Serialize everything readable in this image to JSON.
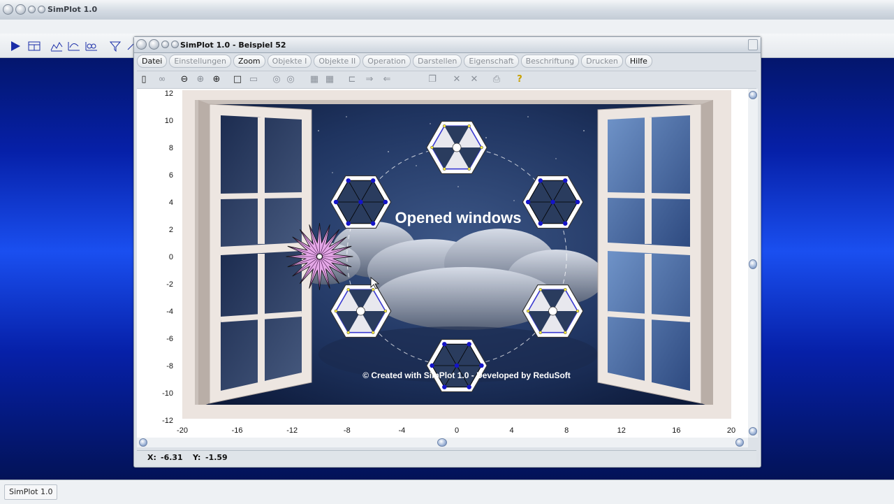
{
  "outer_window": {
    "title": "SimPlot 1.0"
  },
  "taskbar": {
    "item": "SimPlot 1.0"
  },
  "inner_window": {
    "title": "SimPlot 1.0 - Beispiel 52"
  },
  "menu": [
    {
      "label": "Datei",
      "enabled": true
    },
    {
      "label": "Einstellungen",
      "enabled": false
    },
    {
      "label": "Zoom",
      "enabled": true
    },
    {
      "label": "Objekte I",
      "enabled": false
    },
    {
      "label": "Objekte II",
      "enabled": false
    },
    {
      "label": "Operation",
      "enabled": false
    },
    {
      "label": "Darstellen",
      "enabled": false
    },
    {
      "label": "Eigenschaft",
      "enabled": false
    },
    {
      "label": "Beschriftung",
      "enabled": false
    },
    {
      "label": "Drucken",
      "enabled": false
    },
    {
      "label": "Hilfe",
      "enabled": true
    }
  ],
  "plot": {
    "x_ticks": [
      "-20",
      "-16",
      "-12",
      "-8",
      "-4",
      "0",
      "4",
      "8",
      "12",
      "16",
      "20"
    ],
    "y_ticks": [
      "12",
      "10",
      "8",
      "6",
      "4",
      "2",
      "0",
      "-2",
      "-4",
      "-6",
      "-8",
      "-10",
      "-12"
    ],
    "xlim": [
      -20,
      20
    ],
    "ylim": [
      -12,
      12
    ],
    "heading": "Opened windows",
    "credit": "© Created with SimPlot 1.0 - Developed by ReduSoft",
    "hexagons": [
      {
        "x": -7,
        "y": 4,
        "style": "spokes"
      },
      {
        "x": 7,
        "y": 4,
        "style": "spokes"
      },
      {
        "x": 0,
        "y": 8,
        "style": "fan"
      },
      {
        "x": -7,
        "y": -4,
        "style": "fan"
      },
      {
        "x": 7,
        "y": -4,
        "style": "fan"
      },
      {
        "x": 0,
        "y": -8,
        "style": "spokes"
      }
    ],
    "star": {
      "x": -10,
      "y": 0
    },
    "circle": {
      "cx": 0,
      "cy": 0,
      "r": 8
    },
    "colors": {
      "sky": "#223a62",
      "frame": "#e6ddd6",
      "star": "#e6a8e8",
      "marker": "#1414c8"
    }
  },
  "status": {
    "x_label": "X:",
    "x_value": "-6.31",
    "y_label": "Y:",
    "y_value": "-1.59"
  }
}
